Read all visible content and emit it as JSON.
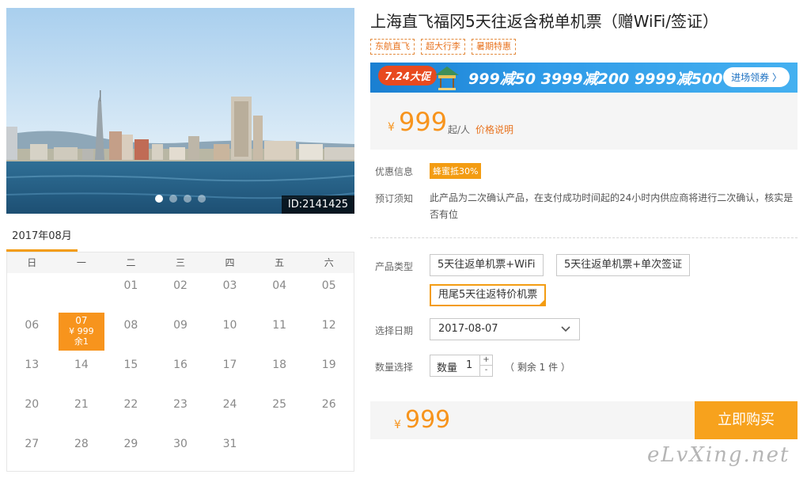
{
  "gallery": {
    "image_id": "ID:2141425",
    "dots": 4,
    "active_dot": 0
  },
  "calendar": {
    "month": "2017年08月",
    "weekdays": [
      "日",
      "一",
      "二",
      "三",
      "四",
      "五",
      "六"
    ],
    "days": [
      "",
      "",
      "01",
      "02",
      "03",
      "04",
      "05",
      "06",
      "07",
      "08",
      "09",
      "10",
      "11",
      "12",
      "13",
      "14",
      "15",
      "16",
      "17",
      "18",
      "19",
      "20",
      "21",
      "22",
      "23",
      "24",
      "25",
      "26",
      "27",
      "28",
      "29",
      "30",
      "31",
      "",
      ""
    ],
    "selected": {
      "day": "07",
      "price": "¥ 999",
      "remain": "余1"
    }
  },
  "product": {
    "title": "上海直飞福冈5天往返含税单机票（赠WiFi/签证）",
    "tags": [
      "东航直飞",
      "超大行李",
      "暑期特惠"
    ]
  },
  "promo": {
    "badge": "7.24大促",
    "text": "999减50  3999减200  9999减500",
    "button": "进场领券 〉"
  },
  "price": {
    "currency": "¥",
    "amount": "999",
    "unit": "起/人",
    "link": "价格说明"
  },
  "info": {
    "discount_label": "优惠信息",
    "discount_badge": "蜂蜜抵30%",
    "notice_label": "预订须知",
    "notice_text": "此产品为二次确认产品，在支付成功时间起的24小时内供应商将进行二次确认，核实是否有位"
  },
  "options": {
    "label": "产品类型",
    "items": [
      "5天往返单机票+WiFi",
      "5天往返单机票+单次签证",
      "甩尾5天往返特价机票"
    ],
    "selected_index": 2
  },
  "date_select": {
    "label": "选择日期",
    "value": "2017-08-07"
  },
  "quantity": {
    "label": "数量选择",
    "field_label": "数量",
    "value": "1",
    "plus": "+",
    "minus": "-",
    "remain": "（ 剩余 1 件 ）"
  },
  "buy": {
    "currency": "¥",
    "amount": "999",
    "button": "立即购买"
  },
  "watermark": "eLvXing.net",
  "colors": {
    "accent": "#f7941d",
    "tag_border": "#e38a3c",
    "promo_blue": "#1a7fd1"
  }
}
